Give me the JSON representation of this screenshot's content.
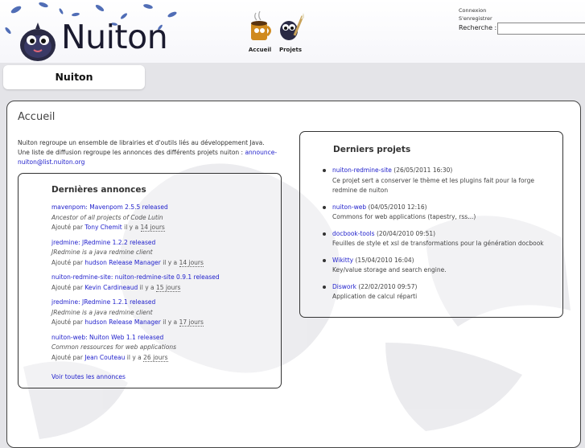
{
  "header": {
    "logo_text": "Nuiton",
    "nav": [
      {
        "label": "Accueil",
        "icon": "coffee-mug-icon"
      },
      {
        "label": "Projets",
        "icon": "mascot-paintbrush-icon"
      }
    ],
    "top_links": [
      "Connexion",
      "S'enregistrer"
    ],
    "search": {
      "label": "Recherche :",
      "value": "",
      "placeholder": ""
    }
  },
  "project_bar": {
    "title": "Nuiton"
  },
  "main": {
    "title": "Accueil",
    "intro_line1": "Nuiton regroupe un ensemble de librairies et d'outils liés au développement Java.",
    "intro_line2": "Une liste de diffusion regroupe les annonces des différents projets nuiton : ",
    "intro_email": "announce-nuiton@list.nuiton.org"
  },
  "news": {
    "title": "Dernières annonces",
    "items": [
      {
        "title": "mavenpom: Mavenpom 2.5.5 released",
        "desc": "Ancestor of all projects of Code Lutin",
        "added_by": "Ajouté par",
        "author": "Tony Chemit",
        "ago_prefix": "il y a",
        "ago": "14 jours"
      },
      {
        "title": "jredmine: JRedmine 1.2.2 released",
        "desc": "JRedmine is a java redmine client",
        "added_by": "Ajouté par",
        "author": "hudson Release Manager",
        "ago_prefix": "il y a",
        "ago": "14 jours"
      },
      {
        "title": "nuiton-redmine-site: nuiton-redmine-site 0.9.1 released",
        "desc": "",
        "added_by": "Ajouté par",
        "author": "Kevin Cardineaud",
        "ago_prefix": "il y a",
        "ago": "15 jours"
      },
      {
        "title": "jredmine: JRedmine 1.2.1 released",
        "desc": "JRedmine is a java redmine client",
        "added_by": "Ajouté par",
        "author": "hudson Release Manager",
        "ago_prefix": "il y a",
        "ago": "17 jours"
      },
      {
        "title": "nuiton-web: Nuiton Web 1.1 released",
        "desc": "Common ressources for web applications",
        "added_by": "Ajouté par",
        "author": "Jean Couteau",
        "ago_prefix": "il y a",
        "ago": "26 jours"
      }
    ],
    "see_all": "Voir toutes les annonces"
  },
  "projects": {
    "title": "Derniers projets",
    "items": [
      {
        "name": "nuiton-redmine-site",
        "date": "(26/05/2011 16:30)",
        "desc": "Ce projet sert a conserver le thème et les plugins fait pour la forge redmine de nuiton"
      },
      {
        "name": "nuiton-web",
        "date": "(04/05/2010 12:16)",
        "desc": "Commons for web applications (tapestry, rss...)"
      },
      {
        "name": "docbook-tools",
        "date": "(20/04/2010 09:51)",
        "desc": "Feuilles de style et xsl de transformations pour la génération docbook"
      },
      {
        "name": "Wikitty",
        "date": "(15/04/2010 16:04)",
        "desc": "Key/value storage and search engine."
      },
      {
        "name": "Diswork",
        "date": "(22/02/2010 09:57)",
        "desc": "Application de calcul réparti"
      }
    ]
  },
  "colors": {
    "link": "#2222cc",
    "background": "#e4e4e8",
    "box_border": "#333333"
  }
}
